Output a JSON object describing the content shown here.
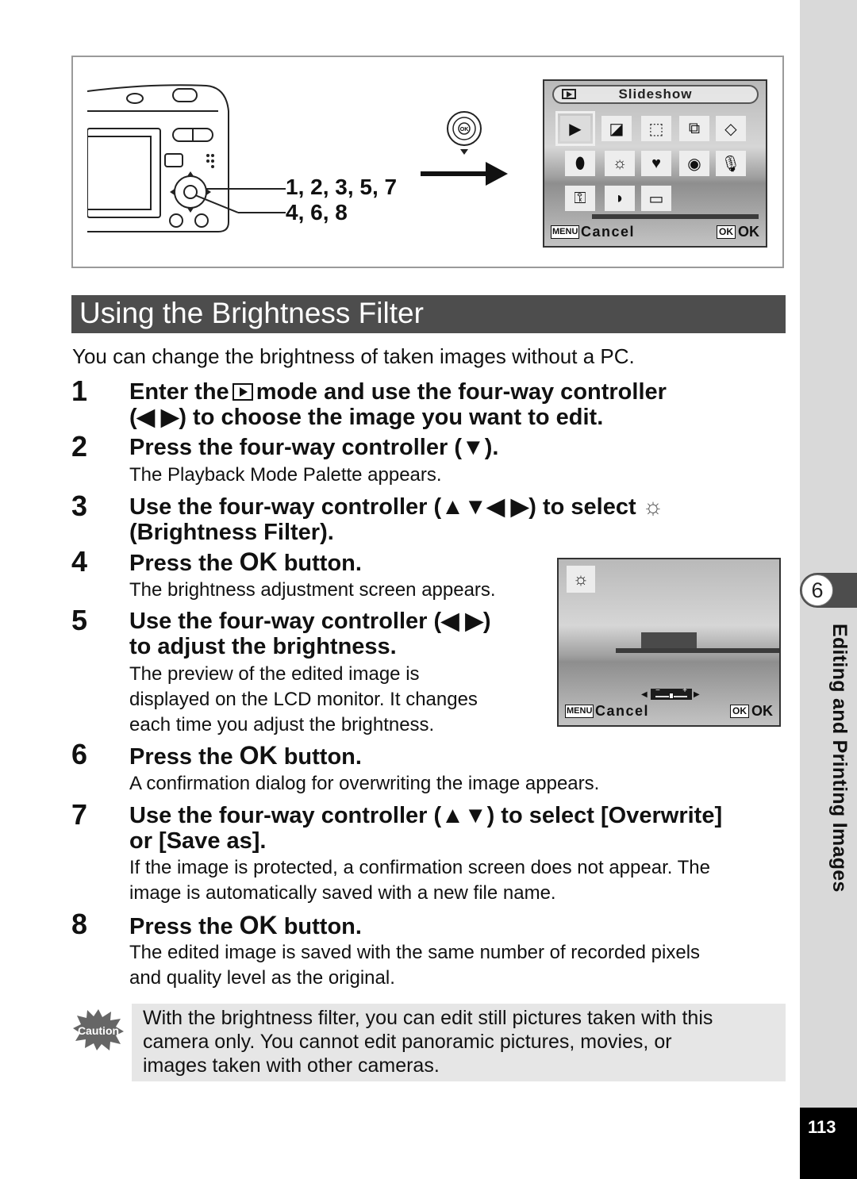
{
  "figure": {
    "callout_top": "1, 2, 3, 5, 7",
    "callout_bottom": "4, 6, 8",
    "palette_screen": {
      "header_title": "Slideshow",
      "icons": [
        "slideshow-icon",
        "resize-icon",
        "trimming-icon",
        "image-copy-icon",
        "rotate-icon",
        "digital-filter-icon",
        "brightness-filter-icon",
        "frame-composite-icon",
        "red-eye-edit-icon",
        "voice-memo-icon",
        "protect-icon",
        "dpof-icon",
        "startup-screen-icon"
      ],
      "menu_key": "MENU",
      "cancel_label": "Cancel",
      "ok_key": "OK",
      "ok_label": "OK"
    }
  },
  "section": {
    "title": "Using the Brightness Filter",
    "intro": "You can change the brightness of taken images without a PC."
  },
  "steps": [
    {
      "num": "1",
      "head_a": "Enter the",
      "head_b": "mode and use the four-way controller",
      "head_c": "(◀ ▶) to choose the image you want to edit."
    },
    {
      "num": "2",
      "head": "Press the four-way controller (▼).",
      "body": "The Playback Mode Palette appears."
    },
    {
      "num": "3",
      "head_a": "Use the four-way controller (▲▼◀ ▶) to select",
      "head_b": "(Brightness Filter)."
    },
    {
      "num": "4",
      "head_a": "Press the",
      "ok": "OK",
      "head_b": "button.",
      "body": "The brightness adjustment screen appears."
    },
    {
      "num": "5",
      "head_a": "Use the four-way controller (◀ ▶)",
      "head_b": "to adjust the brightness.",
      "body": [
        "The preview of the edited image is",
        "displayed on the LCD monitor. It changes",
        "each time you adjust the brightness."
      ]
    },
    {
      "num": "6",
      "head_a": "Press the",
      "ok": "OK",
      "head_b": "button.",
      "body": "A confirmation dialog for overwriting the image appears."
    },
    {
      "num": "7",
      "head_a": "Use the four-way controller (▲▼) to select [Overwrite]",
      "head_b": "or [Save as].",
      "body": [
        "If the image is protected, a confirmation screen does not appear. The",
        "image is automatically saved with a new file name."
      ]
    },
    {
      "num": "8",
      "head_a": "Press the",
      "ok": "OK",
      "head_b": "button.",
      "body": [
        "The edited image is saved with the same number of recorded pixels",
        "and quality level as the original."
      ]
    }
  ],
  "brightness_screen": {
    "menu_key": "MENU",
    "cancel_label": "Cancel",
    "ok_key": "OK",
    "ok_label": "OK",
    "slider_minus": "−",
    "slider_plus": "+",
    "brightness_level": 0.5
  },
  "caution": {
    "badge": "Caution",
    "lines": [
      "With the brightness filter, you can edit still pictures taken with this",
      "camera only. You cannot edit panoramic pictures, movies, or",
      "images taken with other cameras."
    ]
  },
  "sidebar": {
    "chapter_number": "6",
    "chapter_title": "Editing and Printing Images",
    "page_number": "113"
  }
}
